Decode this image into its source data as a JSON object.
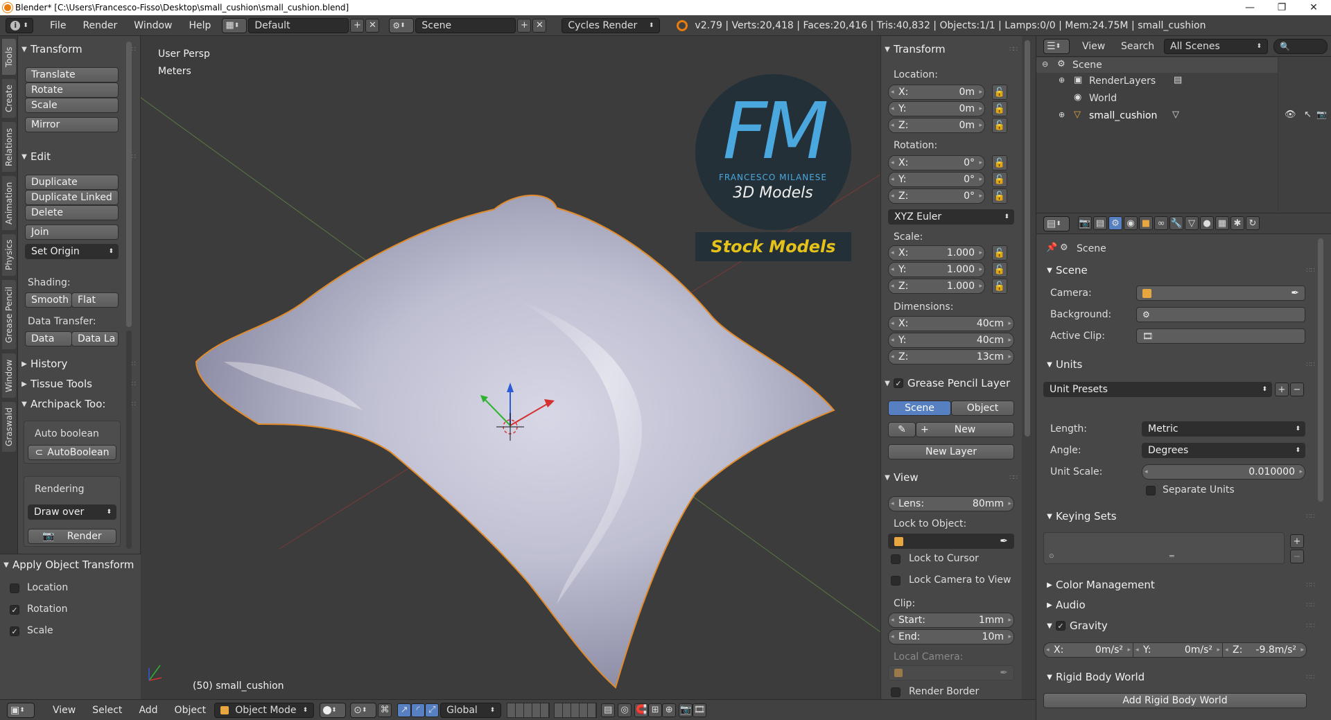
{
  "window": {
    "title": "Blender* [C:\\Users\\Francesco-Fisso\\Desktop\\small_cushion\\small_cushion.blend]",
    "minimize": "—",
    "maximize": "❐",
    "close": "✕"
  },
  "header": {
    "menus": [
      "File",
      "Render",
      "Window",
      "Help"
    ],
    "layout": "Default",
    "scene": "Scene",
    "engine": "Cycles Render",
    "stats": "v2.79 | Verts:20,418 | Faces:20,416 | Tris:40,832 | Objects:1/1 | Lamps:0/0 | Mem:24.75M | small_cushion"
  },
  "vtabs": [
    "Tools",
    "Create",
    "Relations",
    "Animation",
    "Physics",
    "Grease Pencil",
    "Window",
    "Graswald"
  ],
  "tools": {
    "transform_title": "Transform",
    "translate": "Translate",
    "rotate": "Rotate",
    "scale": "Scale",
    "mirror": "Mirror",
    "edit_title": "Edit",
    "duplicate": "Duplicate",
    "duplicate_linked": "Duplicate Linked",
    "delete": "Delete",
    "join": "Join",
    "set_origin": "Set Origin",
    "shading_label": "Shading:",
    "smooth": "Smooth",
    "flat": "Flat",
    "data_transfer_label": "Data Transfer:",
    "data": "Data",
    "data_la": "Data La",
    "history_title": "History",
    "tissue_title": "Tissue Tools",
    "archipack_title": "Archipack Too:",
    "auto_boolean_label": "Auto boolean",
    "auto_boolean_btn": "AutoBoolean",
    "rendering_label": "Rendering",
    "draw_over": "Draw over",
    "render": "Render"
  },
  "apply": {
    "title": "Apply Object Transform",
    "location": "Location",
    "rotation": "Rotation",
    "scale": "Scale",
    "location_checked": false,
    "rotation_checked": true,
    "scale_checked": true
  },
  "viewport": {
    "view_name": "User Persp",
    "units": "Meters",
    "object_label": "(50) small_cushion",
    "logo_letters": "FM",
    "logo_name": "FRANCESCO MILANESE",
    "logo_sub": "3D Models",
    "logo_banner": "Stock Models"
  },
  "npanel": {
    "transform_title": "Transform",
    "location_label": "Location:",
    "loc_x": "0m",
    "loc_y": "0m",
    "loc_z": "0m",
    "rotation_label": "Rotation:",
    "rot_x": "0°",
    "rot_y": "0°",
    "rot_z": "0°",
    "rotation_mode": "XYZ Euler",
    "scale_label": "Scale:",
    "scale_x": "1.000",
    "scale_y": "1.000",
    "scale_z": "1.000",
    "dimensions_label": "Dimensions:",
    "dim_x": "40cm",
    "dim_y": "40cm",
    "dim_z": "13cm",
    "gp_title": "Grease Pencil Layer",
    "gp_scene": "Scene",
    "gp_object": "Object",
    "gp_new": "New",
    "gp_new_layer": "New Layer",
    "view_title": "View",
    "lens_key": "Lens:",
    "lens": "80mm",
    "lock_object_label": "Lock to Object:",
    "lock_cursor": "Lock to Cursor",
    "lock_camera": "Lock Camera to View",
    "clip_label": "Clip:",
    "clip_start_key": "Start:",
    "clip_start": "1mm",
    "clip_end_key": "End:",
    "clip_end": "10m",
    "local_camera_label": "Local Camera:",
    "render_border": "Render Border",
    "x": "X:",
    "y": "Y:",
    "z": "Z:"
  },
  "outliner": {
    "view": "View",
    "search": "Search",
    "scenes_dropdown": "All Scenes",
    "items": [
      "Scene",
      "RenderLayers",
      "World",
      "small_cushion"
    ]
  },
  "properties": {
    "context": "Scene",
    "scene_title": "Scene",
    "camera_label": "Camera:",
    "background_label": "Background:",
    "active_clip_label": "Active Clip:",
    "units_title": "Units",
    "unit_presets": "Unit Presets",
    "length_label": "Length:",
    "length": "Metric",
    "angle_label": "Angle:",
    "angle": "Degrees",
    "unit_scale_label": "Unit Scale:",
    "unit_scale": "0.010000",
    "separate_units": "Separate Units",
    "keying_title": "Keying Sets",
    "color_mgmt_title": "Color Management",
    "audio_title": "Audio",
    "gravity_title": "Gravity",
    "grav_x_key": "X:",
    "grav_x": "0m/s²",
    "grav_y_key": "Y:",
    "grav_y": "0m/s²",
    "grav_z_key": "Z:",
    "grav_z": "-9.8m/s²",
    "rigid_title": "Rigid Body World",
    "add_rigid": "Add Rigid Body World"
  },
  "bottombar": {
    "view": "View",
    "select": "Select",
    "add": "Add",
    "object": "Object",
    "mode": "Object Mode",
    "orientation": "Global"
  },
  "colors": {
    "accent_blue": "#5680c2",
    "cushion_outline": "#e08a2a",
    "logo_bg": "#243038",
    "logo_banner_text": "#e5c21a"
  }
}
